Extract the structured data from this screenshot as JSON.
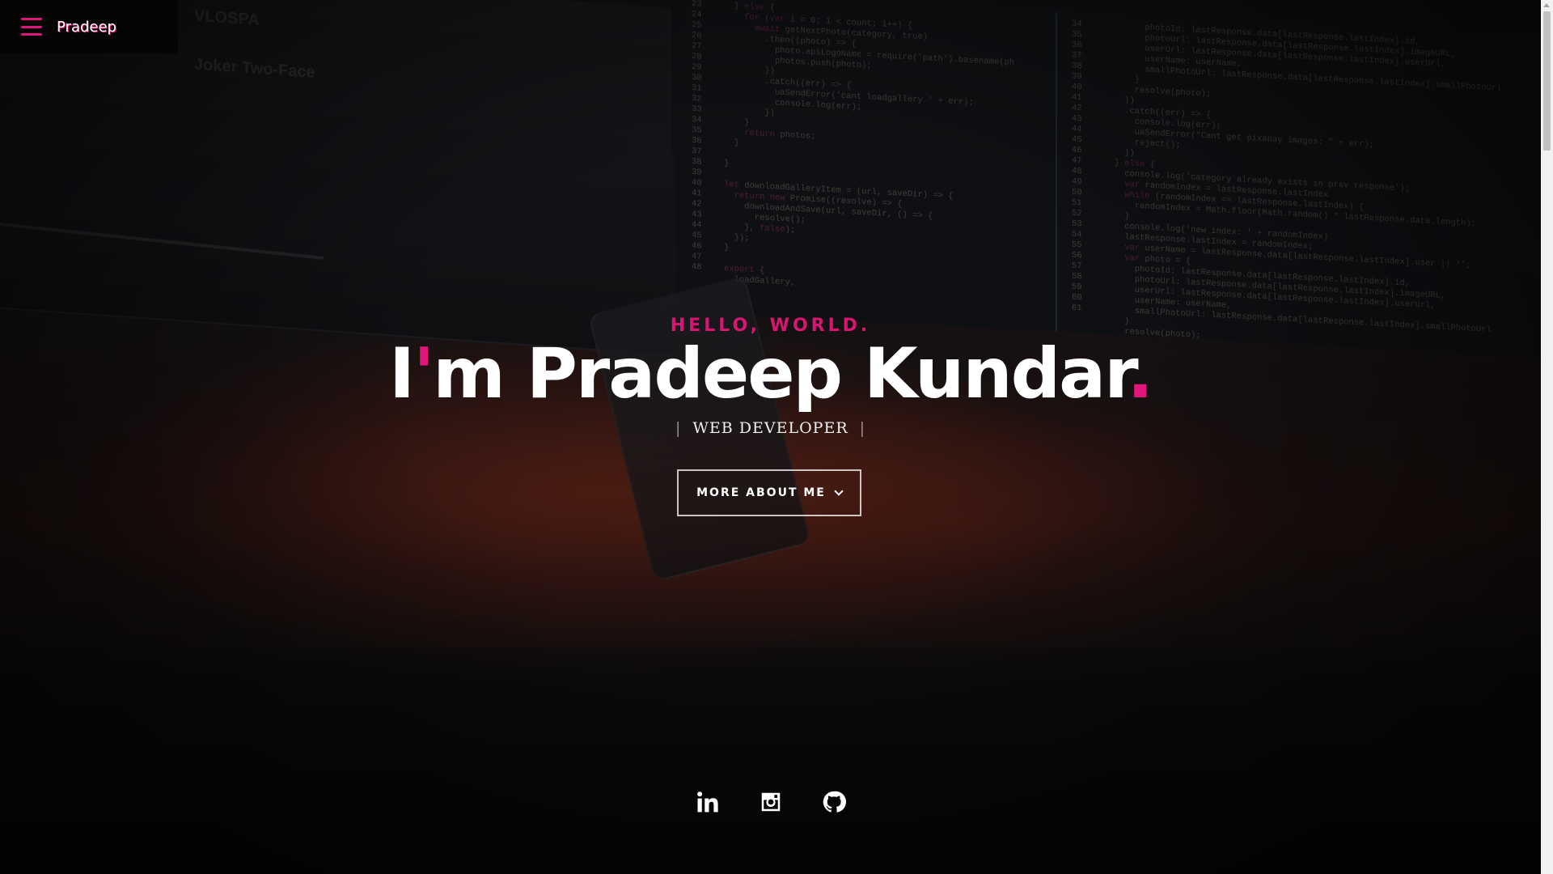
{
  "nav": {
    "menu_icon": "hamburger-menu-icon",
    "brand": "Pradeep"
  },
  "hero": {
    "tagline": "HELLO, WORLD.",
    "name_prefix": "I",
    "name_apostrophe": "'",
    "name_rest": "m Pradeep Kundar",
    "name_dot": ".",
    "role_separator": "|",
    "role": "WEB DEVELOPER",
    "cta_label": "MORE ABOUT ME",
    "cta_icon": "chevron-down-icon"
  },
  "socials": [
    {
      "name": "LinkedIn",
      "icon": "linkedin-icon"
    },
    {
      "name": "Instagram",
      "icon": "instagram-icon"
    },
    {
      "name": "GitHub",
      "icon": "github-icon"
    }
  ],
  "colors": {
    "accent": "#e0167a",
    "text": "#ffffff",
    "nav_bg": "#050505"
  }
}
